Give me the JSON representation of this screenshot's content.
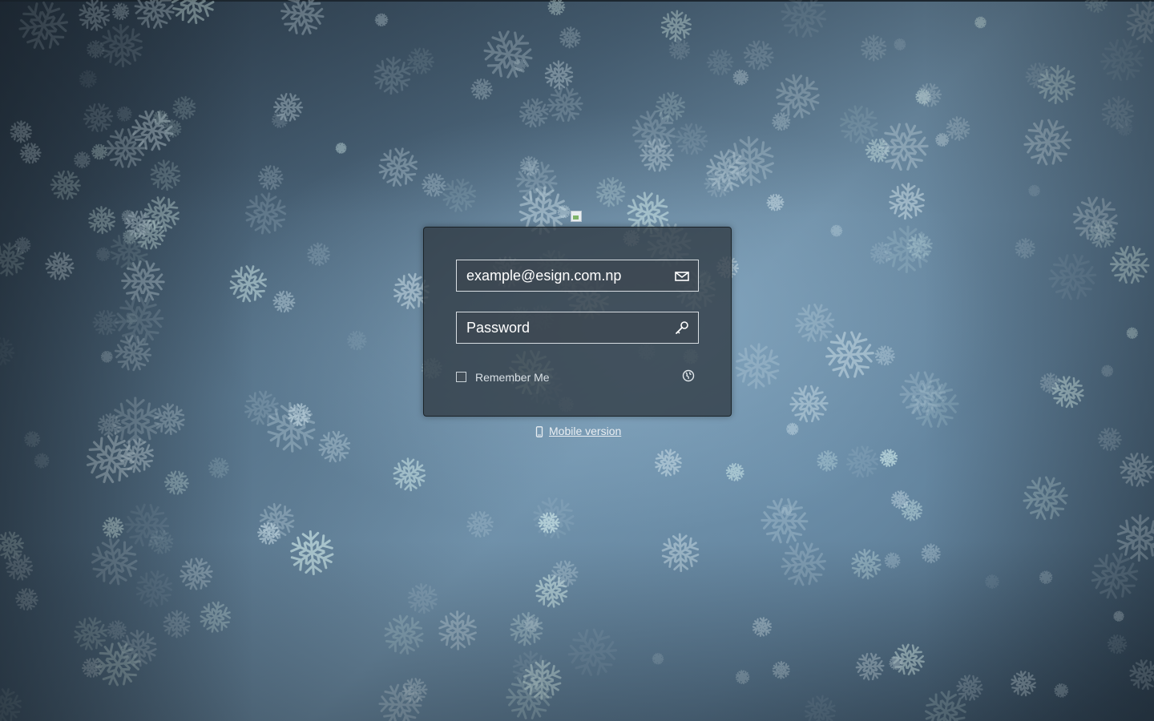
{
  "login": {
    "email_placeholder": "example@esign.com.np",
    "password_placeholder": "Password",
    "remember_label": "Remember Me",
    "mobile_link": "Mobile version"
  },
  "icons": {
    "email": "envelope-icon",
    "password": "key-icon",
    "language": "globe-icon",
    "mobile": "mobile-phone-icon",
    "logo": "broken-image-icon"
  },
  "colors": {
    "panel": "#303a42",
    "field_border": "#d7dde2",
    "text": "#ffffff",
    "background_mid": "#6e8ea6"
  }
}
